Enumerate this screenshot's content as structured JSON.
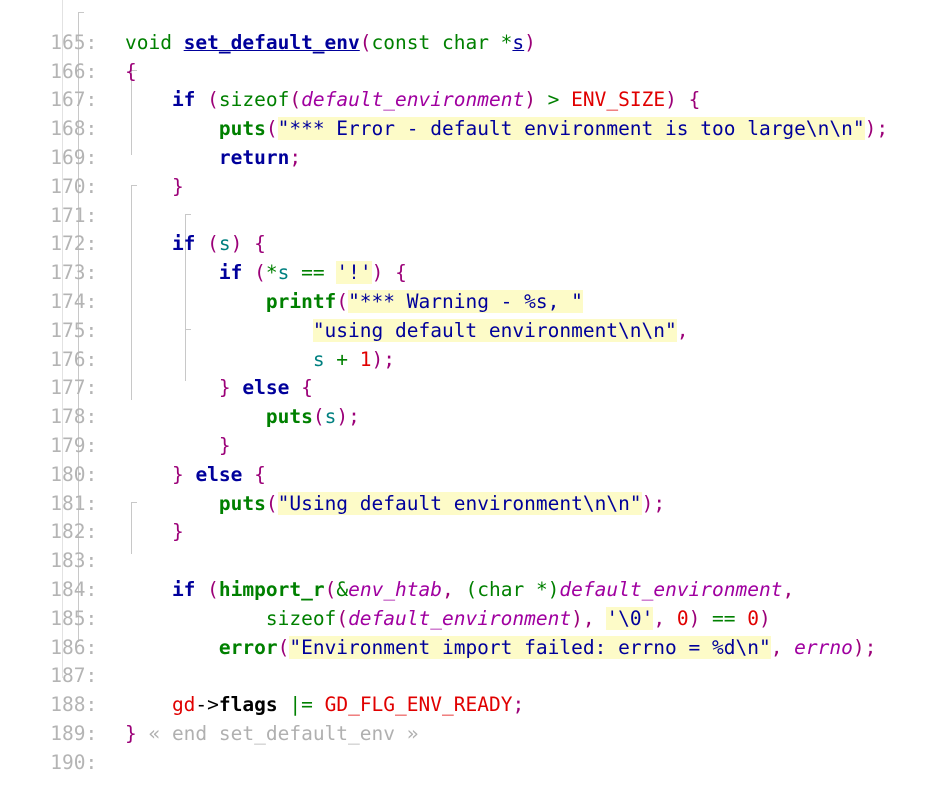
{
  "editor": {
    "title": "set_default_env source view",
    "language": "C",
    "first_line": 165,
    "last_line": 190,
    "gutter_suffix": ":",
    "colors": {
      "background": "#ffffff",
      "line_number": "#b4b4b4",
      "keyword": "#00009b",
      "type": "#008000",
      "function": "#008000",
      "punctuation": "#9b0078",
      "variable_italic": "#a000a0",
      "local_variable": "#008080",
      "macro": "#e00000",
      "number": "#e00000",
      "string": "#00009b",
      "string_highlight": "#fdfbc8",
      "fold_marker": "#b0b0b0",
      "guide": "#c8c8c8"
    }
  },
  "lines": [
    {
      "n": "165",
      "text": "void set_default_env(const char *s)"
    },
    {
      "n": "166",
      "text": "{"
    },
    {
      "n": "167",
      "text": "    if (sizeof(default_environment) > ENV_SIZE) {"
    },
    {
      "n": "168",
      "text": "        puts(\"*** Error - default environment is too large\\n\\n\");"
    },
    {
      "n": "169",
      "text": "        return;"
    },
    {
      "n": "170",
      "text": "    }"
    },
    {
      "n": "171",
      "text": ""
    },
    {
      "n": "172",
      "text": "    if (s) {"
    },
    {
      "n": "173",
      "text": "        if (*s == '!') {"
    },
    {
      "n": "174",
      "text": "            printf(\"*** Warning - %s, \""
    },
    {
      "n": "175",
      "text": "                \"using default environment\\n\\n\","
    },
    {
      "n": "176",
      "text": "                s + 1);"
    },
    {
      "n": "177",
      "text": "        } else {"
    },
    {
      "n": "178",
      "text": "            puts(s);"
    },
    {
      "n": "179",
      "text": "        }"
    },
    {
      "n": "180",
      "text": "    } else {"
    },
    {
      "n": "181",
      "text": "        puts(\"Using default environment\\n\\n\");"
    },
    {
      "n": "182",
      "text": "    }"
    },
    {
      "n": "183",
      "text": ""
    },
    {
      "n": "184",
      "text": "    if (himport_r(&env_htab, (char *)default_environment,"
    },
    {
      "n": "185",
      "text": "            sizeof(default_environment), '\\0', 0) == 0)"
    },
    {
      "n": "186",
      "text": "        error(\"Environment import failed: errno = %d\\n\", errno);"
    },
    {
      "n": "187",
      "text": ""
    },
    {
      "n": "188",
      "text": "    gd->flags |= GD_FLG_ENV_READY;"
    },
    {
      "n": "189",
      "text": "} « end set_default_env »"
    },
    {
      "n": "190",
      "text": ""
    }
  ],
  "tokens": {
    "l165": {
      "t1": "void ",
      "t2": "set_default_env",
      "t3": "(",
      "t4": "const char ",
      "t5": "*",
      "t6": "s",
      "t7": ")"
    },
    "l166": {
      "t1": "{"
    },
    "l167": {
      "ind": "    ",
      "t1": "if",
      "t2": " ",
      "t3": "(",
      "t4": "sizeof",
      "t5": "(",
      "t6": "default_environment",
      "t7": ")",
      "t8": " > ",
      "t9": "ENV_SIZE",
      "t10": ")",
      "t11": " ",
      "t12": "{"
    },
    "l168": {
      "ind": "        ",
      "t1": "puts",
      "t2": "(",
      "t3": "\"*** Error - default environment is too large\\n\\n\"",
      "t4": ")",
      "t5": ";"
    },
    "l169": {
      "ind": "        ",
      "t1": "return",
      "t2": ";"
    },
    "l170": {
      "ind": "    ",
      "t1": "}"
    },
    "l172": {
      "ind": "    ",
      "t1": "if",
      "t2": " ",
      "t3": "(",
      "t4": "s",
      "t5": ")",
      "t6": " ",
      "t7": "{"
    },
    "l173": {
      "ind": "        ",
      "t1": "if",
      "t2": " ",
      "t3": "(",
      "t4": "*",
      "t5": "s",
      "t6": " == ",
      "t7": "'!'",
      "t8": ")",
      "t9": " ",
      "t10": "{"
    },
    "l174": {
      "ind": "            ",
      "t1": "printf",
      "t2": "(",
      "t3": "\"*** Warning - %s, \""
    },
    "l175": {
      "ind": "                ",
      "t1": "\"using default environment\\n\\n\"",
      "t2": ","
    },
    "l176": {
      "ind": "                ",
      "t1": "s",
      "t2": " + ",
      "t3": "1",
      "t4": ")",
      "t5": ";"
    },
    "l177": {
      "ind": "        ",
      "t1": "}",
      "t2": " ",
      "t3": "else",
      "t4": " ",
      "t5": "{"
    },
    "l178": {
      "ind": "            ",
      "t1": "puts",
      "t2": "(",
      "t3": "s",
      "t4": ")",
      "t5": ";"
    },
    "l179": {
      "ind": "        ",
      "t1": "}"
    },
    "l180": {
      "ind": "    ",
      "t1": "}",
      "t2": " ",
      "t3": "else",
      "t4": " ",
      "t5": "{"
    },
    "l181": {
      "ind": "        ",
      "t1": "puts",
      "t2": "(",
      "t3": "\"Using default environment\\n\\n\"",
      "t4": ")",
      "t5": ";"
    },
    "l182": {
      "ind": "    ",
      "t1": "}"
    },
    "l184": {
      "ind": "    ",
      "t1": "if",
      "t2": " ",
      "t3": "(",
      "t4": "himport_r",
      "t5": "(",
      "t6": "&",
      "t7": "env_htab",
      "t8": ", ",
      "t9": "(char *)",
      "t10": "default_environment",
      "t11": ","
    },
    "l185": {
      "ind": "            ",
      "t1": "sizeof",
      "t2": "(",
      "t3": "default_environment",
      "t4": ")",
      "t5": ", ",
      "t6": "'\\0'",
      "t7": ", ",
      "t8": "0",
      "t9": ")",
      "t10": " == ",
      "t11": "0",
      "t12": ")"
    },
    "l186": {
      "ind": "        ",
      "t1": "error",
      "t2": "(",
      "t3": "\"Environment import failed: errno = %d\\n\"",
      "t4": ", ",
      "t5": "errno",
      "t6": ")",
      "t7": ";"
    },
    "l188": {
      "ind": "    ",
      "t1": "gd",
      "t2": "->",
      "t3": "flags",
      "t4": " ",
      "t5": "|=",
      "t6": " ",
      "t7": "GD_FLG_ENV_READY",
      "t8": ";"
    },
    "l189": {
      "t1": "}",
      "t2": " « end set_default_env »"
    }
  }
}
